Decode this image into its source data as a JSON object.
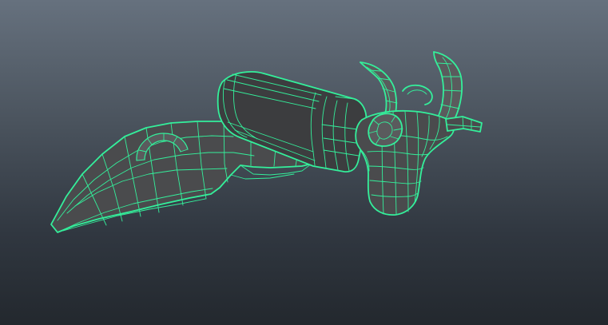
{
  "viewport": {
    "background_top": "#66717e",
    "background_bottom": "#23282e",
    "wireframe_color": "#34ef9b",
    "shading_color": "#3c3d3f"
  },
  "model": {
    "parts": [
      "blade-mesh",
      "handle-cylinder",
      "ring-handle",
      "bull-head",
      "left-horn",
      "right-horn",
      "nose-ring"
    ]
  }
}
